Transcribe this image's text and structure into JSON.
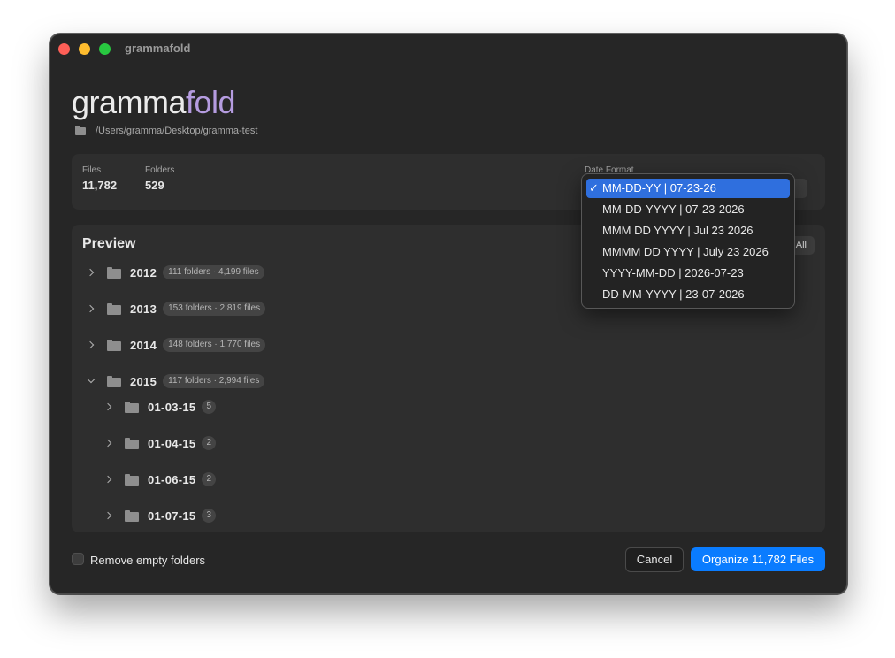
{
  "window": {
    "title": "grammafold"
  },
  "brand": {
    "part1": "gramma",
    "part2": "fold"
  },
  "path": "/Users/gramma/Desktop/gramma-test",
  "stats": {
    "files_label": "Files",
    "files_value": "11,782",
    "folders_label": "Folders",
    "folders_value": "529",
    "date_format_label": "Date Format"
  },
  "preview": {
    "title": "Preview",
    "expand_label": "All",
    "years": [
      {
        "label": "2012",
        "info": "111 folders · 4,199 files",
        "expanded": false
      },
      {
        "label": "2013",
        "info": "153 folders · 2,819 files",
        "expanded": false
      },
      {
        "label": "2014",
        "info": "148 folders · 1,770 files",
        "expanded": false
      },
      {
        "label": "2015",
        "info": "117 folders · 2,994 files",
        "expanded": true
      }
    ],
    "children": [
      {
        "label": "01-03-15",
        "count": "5"
      },
      {
        "label": "01-04-15",
        "count": "2"
      },
      {
        "label": "01-06-15",
        "count": "2"
      },
      {
        "label": "01-07-15",
        "count": "3"
      }
    ]
  },
  "bottom": {
    "remove_empty_label": "Remove empty folders",
    "cancel_label": "Cancel",
    "organize_label": "Organize 11,782 Files"
  },
  "date_menu": {
    "check_icon": "✓",
    "options": [
      "MM-DD-YY | 07-23-26",
      "MM-DD-YYYY | 07-23-2026",
      "MMM DD YYYY | Jul 23 2026",
      "MMMM DD YYYY | July 23 2026",
      "YYYY-MM-DD | 2026-07-23",
      "DD-MM-YYYY | 23-07-2026"
    ],
    "selected": 0
  },
  "colors": {
    "accent": "#0a7cff",
    "brand_accent": "#b59ce0",
    "menu_selected": "#2f6fde"
  }
}
